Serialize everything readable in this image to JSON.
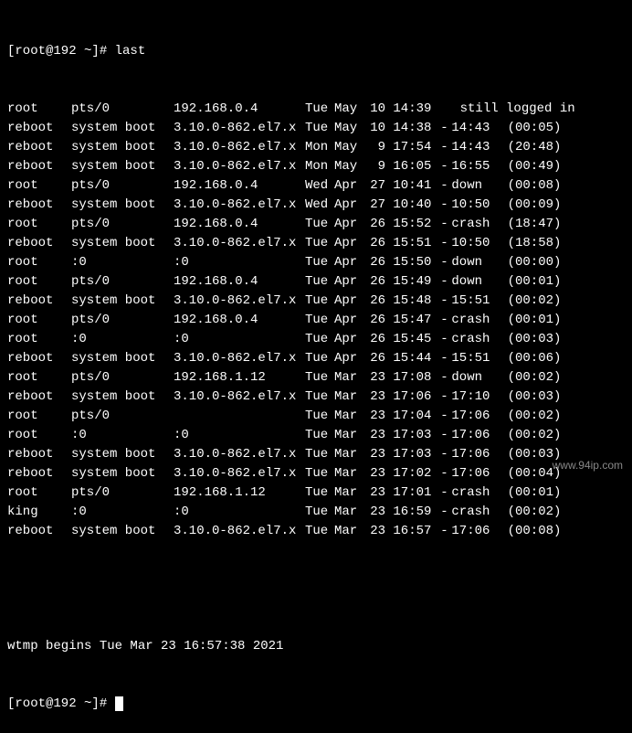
{
  "prompt_start": "[root@192 ~]# ",
  "command": "last",
  "entries": [
    {
      "user": "root",
      "tty": "pts/0",
      "host": "192.168.0.4",
      "day": "Tue",
      "mon": "May",
      "dnum": "10",
      "time": "14:39",
      "still": "still logged in"
    },
    {
      "user": "reboot",
      "tty": "system boot",
      "host": "3.10.0-862.el7.x",
      "day": "Tue",
      "mon": "May",
      "dnum": "10",
      "time": "14:38",
      "sep": "-",
      "end": "14:43",
      "dur": "(00:05)"
    },
    {
      "user": "reboot",
      "tty": "system boot",
      "host": "3.10.0-862.el7.x",
      "day": "Mon",
      "mon": "May",
      "dnum": "9",
      "time": "17:54",
      "sep": "-",
      "end": "14:43",
      "dur": "(20:48)"
    },
    {
      "user": "reboot",
      "tty": "system boot",
      "host": "3.10.0-862.el7.x",
      "day": "Mon",
      "mon": "May",
      "dnum": "9",
      "time": "16:05",
      "sep": "-",
      "end": "16:55",
      "dur": "(00:49)"
    },
    {
      "user": "root",
      "tty": "pts/0",
      "host": "192.168.0.4",
      "day": "Wed",
      "mon": "Apr",
      "dnum": "27",
      "time": "10:41",
      "sep": "-",
      "end": "down",
      "dur": "(00:08)"
    },
    {
      "user": "reboot",
      "tty": "system boot",
      "host": "3.10.0-862.el7.x",
      "day": "Wed",
      "mon": "Apr",
      "dnum": "27",
      "time": "10:40",
      "sep": "-",
      "end": "10:50",
      "dur": "(00:09)"
    },
    {
      "user": "root",
      "tty": "pts/0",
      "host": "192.168.0.4",
      "day": "Tue",
      "mon": "Apr",
      "dnum": "26",
      "time": "15:52",
      "sep": "-",
      "end": "crash",
      "dur": "(18:47)"
    },
    {
      "user": "reboot",
      "tty": "system boot",
      "host": "3.10.0-862.el7.x",
      "day": "Tue",
      "mon": "Apr",
      "dnum": "26",
      "time": "15:51",
      "sep": "-",
      "end": "10:50",
      "dur": "(18:58)"
    },
    {
      "user": "root",
      "tty": ":0",
      "host": ":0",
      "day": "Tue",
      "mon": "Apr",
      "dnum": "26",
      "time": "15:50",
      "sep": "-",
      "end": "down",
      "dur": "(00:00)"
    },
    {
      "user": "root",
      "tty": "pts/0",
      "host": "192.168.0.4",
      "day": "Tue",
      "mon": "Apr",
      "dnum": "26",
      "time": "15:49",
      "sep": "-",
      "end": "down",
      "dur": "(00:01)"
    },
    {
      "user": "reboot",
      "tty": "system boot",
      "host": "3.10.0-862.el7.x",
      "day": "Tue",
      "mon": "Apr",
      "dnum": "26",
      "time": "15:48",
      "sep": "-",
      "end": "15:51",
      "dur": "(00:02)"
    },
    {
      "user": "root",
      "tty": "pts/0",
      "host": "192.168.0.4",
      "day": "Tue",
      "mon": "Apr",
      "dnum": "26",
      "time": "15:47",
      "sep": "-",
      "end": "crash",
      "dur": "(00:01)"
    },
    {
      "user": "root",
      "tty": ":0",
      "host": ":0",
      "day": "Tue",
      "mon": "Apr",
      "dnum": "26",
      "time": "15:45",
      "sep": "-",
      "end": "crash",
      "dur": "(00:03)"
    },
    {
      "user": "reboot",
      "tty": "system boot",
      "host": "3.10.0-862.el7.x",
      "day": "Tue",
      "mon": "Apr",
      "dnum": "26",
      "time": "15:44",
      "sep": "-",
      "end": "15:51",
      "dur": "(00:06)"
    },
    {
      "user": "root",
      "tty": "pts/0",
      "host": "192.168.1.12",
      "day": "Tue",
      "mon": "Mar",
      "dnum": "23",
      "time": "17:08",
      "sep": "-",
      "end": "down",
      "dur": "(00:02)"
    },
    {
      "user": "reboot",
      "tty": "system boot",
      "host": "3.10.0-862.el7.x",
      "day": "Tue",
      "mon": "Mar",
      "dnum": "23",
      "time": "17:06",
      "sep": "-",
      "end": "17:10",
      "dur": "(00:03)"
    },
    {
      "user": "root",
      "tty": "pts/0",
      "host": "",
      "day": "Tue",
      "mon": "Mar",
      "dnum": "23",
      "time": "17:04",
      "sep": "-",
      "end": "17:06",
      "dur": "(00:02)"
    },
    {
      "user": "root",
      "tty": ":0",
      "host": ":0",
      "day": "Tue",
      "mon": "Mar",
      "dnum": "23",
      "time": "17:03",
      "sep": "-",
      "end": "17:06",
      "dur": "(00:02)"
    },
    {
      "user": "reboot",
      "tty": "system boot",
      "host": "3.10.0-862.el7.x",
      "day": "Tue",
      "mon": "Mar",
      "dnum": "23",
      "time": "17:03",
      "sep": "-",
      "end": "17:06",
      "dur": "(00:03)"
    },
    {
      "user": "reboot",
      "tty": "system boot",
      "host": "3.10.0-862.el7.x",
      "day": "Tue",
      "mon": "Mar",
      "dnum": "23",
      "time": "17:02",
      "sep": "-",
      "end": "17:06",
      "dur": "(00:04)"
    },
    {
      "user": "root",
      "tty": "pts/0",
      "host": "192.168.1.12",
      "day": "Tue",
      "mon": "Mar",
      "dnum": "23",
      "time": "17:01",
      "sep": "-",
      "end": "crash",
      "dur": "(00:01)"
    },
    {
      "user": "king",
      "tty": ":0",
      "host": ":0",
      "day": "Tue",
      "mon": "Mar",
      "dnum": "23",
      "time": "16:59",
      "sep": "-",
      "end": "crash",
      "dur": "(00:02)"
    },
    {
      "user": "reboot",
      "tty": "system boot",
      "host": "3.10.0-862.el7.x",
      "day": "Tue",
      "mon": "Mar",
      "dnum": "23",
      "time": "16:57",
      "sep": "-",
      "end": "17:06",
      "dur": "(00:08)"
    }
  ],
  "footer": "wtmp begins Tue Mar 23 16:57:38 2021",
  "prompt_end": "[root@192 ~]# ",
  "watermark": "www.94ip.com"
}
